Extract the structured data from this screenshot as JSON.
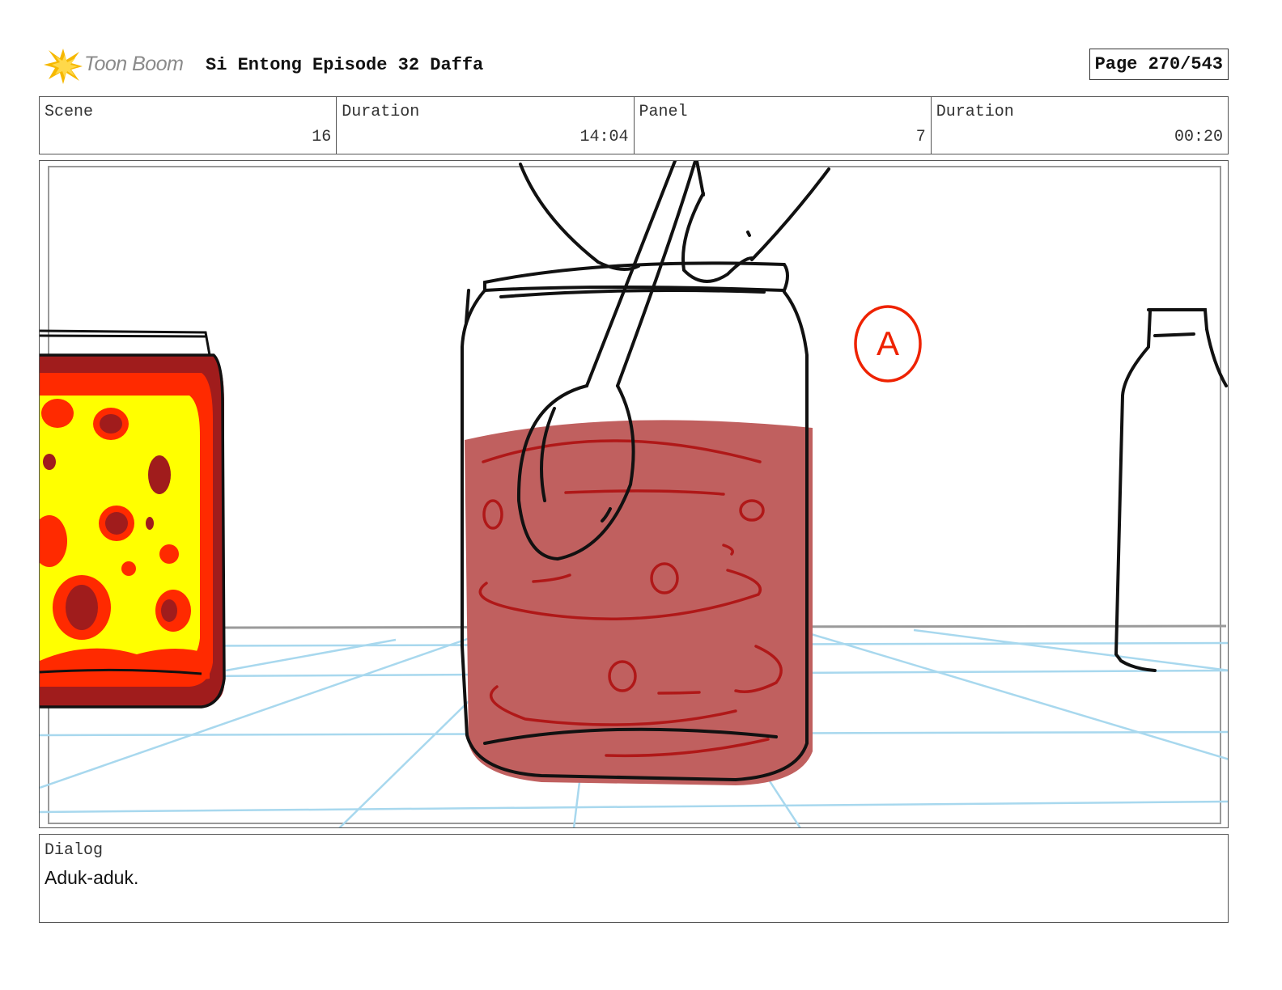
{
  "header": {
    "logo_text": "Toon Boom",
    "title": "Si Entong Episode 32 Daffa",
    "page": "Page 270/543"
  },
  "info": {
    "scene_label": "Scene",
    "scene_value": "16",
    "scene_duration_label": "Duration",
    "scene_duration_value": "14:04",
    "panel_label": "Panel",
    "panel_value": "7",
    "panel_duration_label": "Duration",
    "panel_duration_value": "00:20"
  },
  "panel": {
    "annotation_mark": "A"
  },
  "dialog": {
    "label": "Dialog",
    "text": "Aduk-aduk."
  },
  "colors": {
    "sauce": "#c0605f",
    "sauce_lines": "#b01818",
    "chili_yellow": "#ffff00",
    "chili_red": "#ff2a00",
    "chili_dark": "#a01c1c",
    "floor_grid": "#a8d8ee",
    "annotation": "#ee2200"
  }
}
